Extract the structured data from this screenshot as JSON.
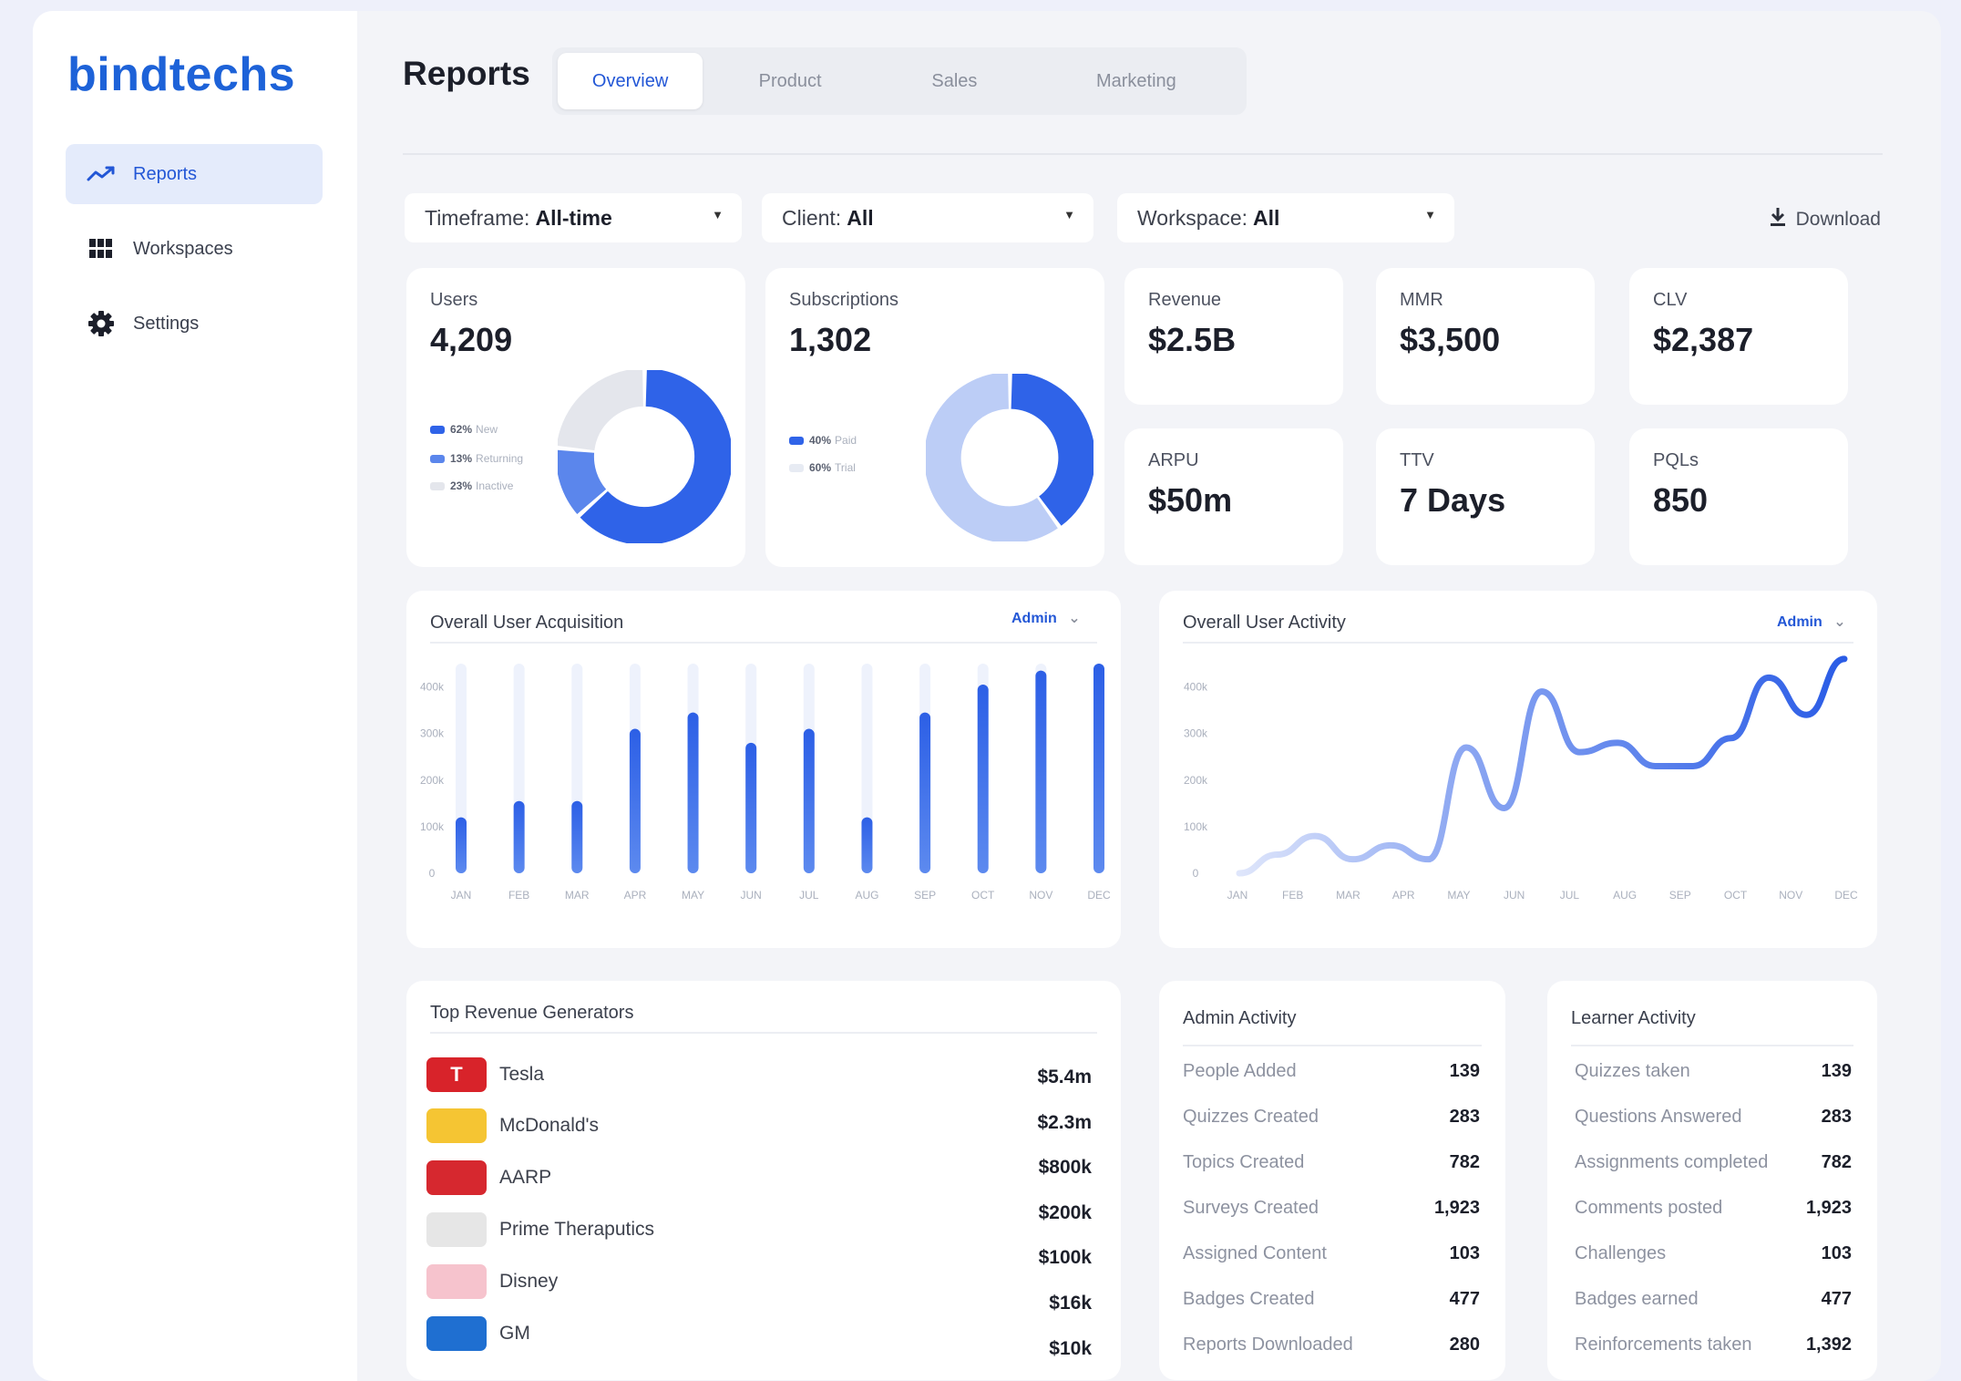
{
  "brand": {
    "logo_text": "bindtechs"
  },
  "sidebar": {
    "items": [
      {
        "label": "Reports",
        "icon": "trend-line-icon",
        "active": true
      },
      {
        "label": "Workspaces",
        "icon": "grid-icon",
        "active": false
      },
      {
        "label": "Settings",
        "icon": "gear-icon",
        "active": false
      }
    ]
  },
  "header": {
    "title": "Reports",
    "tabs": [
      {
        "label": "Overview",
        "active": true
      },
      {
        "label": "Product",
        "active": false
      },
      {
        "label": "Sales",
        "active": false
      },
      {
        "label": "Marketing",
        "active": false
      }
    ]
  },
  "filters": {
    "timeframe": {
      "label": "Timeframe:",
      "value": "All-time"
    },
    "client": {
      "label": "Client:",
      "value": "All"
    },
    "workspace": {
      "label": "Workspace:",
      "value": "All"
    },
    "download_label": "Download"
  },
  "kpis": {
    "users": {
      "label": "Users",
      "value": "4,209",
      "legend": [
        {
          "pct": "62%",
          "name": "New",
          "color": "#2f63e8"
        },
        {
          "pct": "13%",
          "name": "Returning",
          "color": "#5b86ec"
        },
        {
          "pct": "23%",
          "name": "Inactive",
          "color": "#e4e6ec"
        }
      ]
    },
    "subscriptions": {
      "label": "Subscriptions",
      "value": "1,302",
      "legend": [
        {
          "pct": "40%",
          "name": "Paid",
          "color": "#2f63e8"
        },
        {
          "pct": "60%",
          "name": "Trial",
          "color": "#e7ebf3"
        }
      ]
    },
    "revenue": {
      "label": "Revenue",
      "value": "$2.5B"
    },
    "mmr": {
      "label": "MMR",
      "value": "$3,500"
    },
    "clv": {
      "label": "CLV",
      "value": "$2,387"
    },
    "arpu": {
      "label": "ARPU",
      "value": "$50m"
    },
    "ttv": {
      "label": "TTV",
      "value": "7 Days"
    },
    "pqls": {
      "label": "PQLs",
      "value": "850"
    }
  },
  "acquisition": {
    "title": "Overall User Acquisition",
    "selector": "Admin"
  },
  "activity": {
    "title": "Overall User Activity",
    "selector": "Admin"
  },
  "chart_data": [
    {
      "type": "pie",
      "title": "Users",
      "labels": [
        "New",
        "Returning",
        "Inactive"
      ],
      "values": [
        62,
        13,
        23
      ]
    },
    {
      "type": "pie",
      "title": "Subscriptions",
      "labels": [
        "Paid",
        "Trial"
      ],
      "values": [
        40,
        60
      ]
    },
    {
      "type": "bar",
      "title": "Overall User Acquisition",
      "categories": [
        "JAN",
        "FEB",
        "MAR",
        "APR",
        "MAY",
        "JUN",
        "JUL",
        "AUG",
        "SEP",
        "OCT",
        "NOV",
        "DEC"
      ],
      "values": [
        120000,
        155000,
        155000,
        310000,
        345000,
        280000,
        310000,
        120000,
        345000,
        405000,
        435000,
        450000
      ],
      "yticks": [
        "400k",
        "300k",
        "200k",
        "100k",
        "0"
      ],
      "ylim": [
        0,
        450000
      ]
    },
    {
      "type": "line",
      "title": "Overall User Activity",
      "categories": [
        "JAN",
        "FEB",
        "MAR",
        "APR",
        "MAY",
        "JUN",
        "JUL",
        "AUG",
        "SEP",
        "OCT",
        "NOV",
        "DEC"
      ],
      "values": [
        0,
        40000,
        80000,
        30000,
        60000,
        30000,
        270000,
        140000,
        390000,
        260000,
        280000,
        230000,
        230000,
        290000,
        420000,
        340000,
        460000
      ],
      "yticks": [
        "400k",
        "300k",
        "200k",
        "100k",
        "0"
      ],
      "ylim": [
        0,
        450000
      ]
    }
  ],
  "top_revenue": {
    "title": "Top Revenue Generators",
    "items": [
      {
        "name": "Tesla",
        "value": "$5.4m",
        "color": "#d8232a",
        "glyph": "T"
      },
      {
        "name": "McDonald's",
        "value": "$2.3m",
        "color": "#f5c533",
        "glyph": ""
      },
      {
        "name": "AARP",
        "value": "$800k",
        "color": "#d6282f",
        "glyph": ""
      },
      {
        "name": "Prime Theraputics",
        "value": "$200k",
        "color": "#e6e6e6",
        "glyph": ""
      },
      {
        "name": "Disney",
        "value": "$100k",
        "color": "#f6c3cd",
        "glyph": ""
      },
      {
        "name": "GM",
        "value": "$16k",
        "color": "#1f6fd1",
        "glyph": ""
      }
    ],
    "extra_value": "$10k"
  },
  "admin_activity": {
    "title": "Admin Activity",
    "rows": [
      {
        "label": "People Added",
        "value": "139"
      },
      {
        "label": "Quizzes Created",
        "value": "283"
      },
      {
        "label": "Topics Created",
        "value": "782"
      },
      {
        "label": "Surveys Created",
        "value": "1,923"
      },
      {
        "label": "Assigned Content",
        "value": "103"
      },
      {
        "label": "Badges Created",
        "value": "477"
      },
      {
        "label": "Reports Downloaded",
        "value": "280"
      }
    ]
  },
  "learner_activity": {
    "title": "Learner Activity",
    "rows": [
      {
        "label": "Quizzes taken",
        "value": "139"
      },
      {
        "label": "Questions Answered",
        "value": "283"
      },
      {
        "label": "Assignments completed",
        "value": "782"
      },
      {
        "label": "Comments posted",
        "value": "1,923"
      },
      {
        "label": "Challenges",
        "value": "103"
      },
      {
        "label": "Badges earned",
        "value": "477"
      },
      {
        "label": "Reinforcements taken",
        "value": "1,392"
      }
    ]
  }
}
